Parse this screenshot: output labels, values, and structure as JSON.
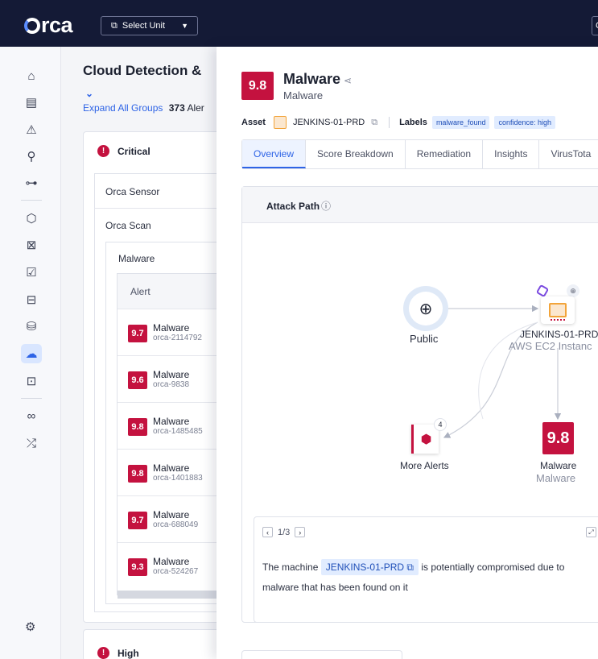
{
  "topbar": {
    "logo": "orca",
    "unit_select": "Select Unit",
    "right_btn": "C"
  },
  "nav_icons": [
    "home-icon",
    "dashboard-icon",
    "alerts-icon",
    "search-icon",
    "graph-icon",
    "shield-icon",
    "compliance-icon",
    "checklist-icon",
    "inventory-icon",
    "database-icon",
    "cloud-icon",
    "identity-icon",
    "infinity-icon",
    "shuffle-icon",
    "settings-icon"
  ],
  "page": {
    "title": "Cloud Detection &",
    "expand_all": "Expand All Groups",
    "alert_count": "373",
    "alert_suffix": "Aler",
    "critical_label": "Critical",
    "group1": "Orca Sensor",
    "group2": "Orca Scan",
    "subgroup": "Malware",
    "table_header": "Alert",
    "high_label": "High",
    "alerts": [
      {
        "score": "9.7",
        "name": "Malware",
        "id": "orca-2114792"
      },
      {
        "score": "9.6",
        "name": "Malware",
        "id": "orca-9838"
      },
      {
        "score": "9.8",
        "name": "Malware",
        "id": "orca-1485485"
      },
      {
        "score": "9.8",
        "name": "Malware",
        "id": "orca-1401883"
      },
      {
        "score": "9.7",
        "name": "Malware",
        "id": "orca-688049"
      },
      {
        "score": "9.3",
        "name": "Malware",
        "id": "orca-524267"
      }
    ]
  },
  "drawer": {
    "score": "9.8",
    "title": "Malware",
    "subtitle": "Malware",
    "asset_label": "Asset",
    "asset_name": "JENKINS-01-PRD",
    "labels_label": "Labels",
    "chips": [
      "malware_found",
      "confidence: high"
    ],
    "tabs": [
      "Overview",
      "Score Breakdown",
      "Remediation",
      "Insights",
      "VirusTota"
    ],
    "attack_path": "Attack Path",
    "nodes": {
      "public": "Public",
      "ec2_name": "JENKINS-01-PRD",
      "ec2_type": "AWS EC2 Instanc",
      "more_alerts": "More Alerts",
      "more_count": "4",
      "malware_score": "9.8",
      "malware_name": "Malware",
      "malware_type": "Malware"
    },
    "pager": "1/3",
    "desc_before": "The machine",
    "desc_asset": "JENKINS-01-PRD",
    "desc_after": "is potentially compromised due to malware that has been found on it"
  },
  "colors": {
    "topbar": "#141a36",
    "critical": "#c4123f",
    "accent": "#2d63e6"
  }
}
